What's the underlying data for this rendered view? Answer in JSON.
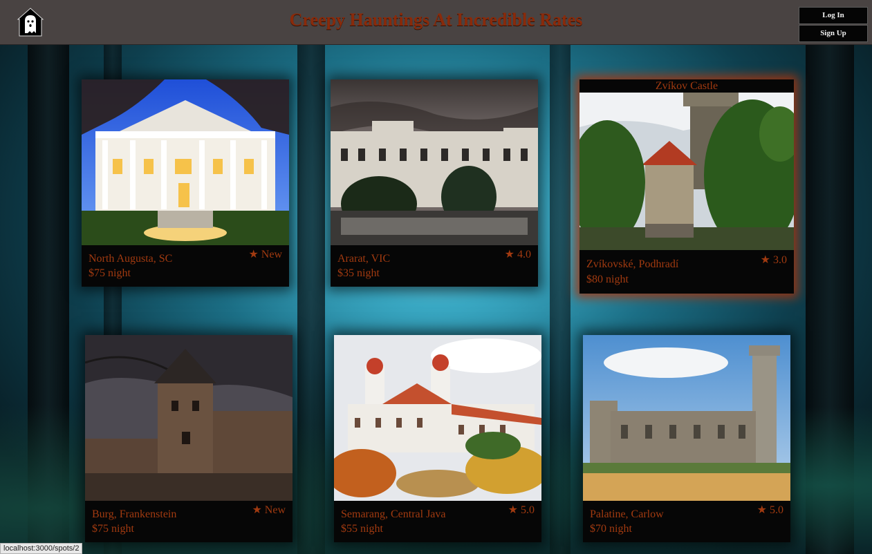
{
  "header": {
    "title": "Creepy Hauntings At Incredible Rates",
    "logo_icon": "ghost-house-icon",
    "login_label": "Log In",
    "signup_label": "Sign Up"
  },
  "colors": {
    "accent": "#a13a10",
    "header_bg": "#494342",
    "card_bg": "#060606"
  },
  "listings": [
    {
      "location": "North Augusta, SC",
      "price": "$75 night",
      "rating": "★ New"
    },
    {
      "location": "Ararat, VIC",
      "price": "$35 night",
      "rating": "★ 4.0"
    },
    {
      "name": "Zvíkov Castle",
      "location": "Zvíkovské, Podhradí",
      "price": "$80 night",
      "rating": "★ 3.0"
    },
    {
      "location": "Burg, Frankenstein",
      "price": "$75 night",
      "rating": "★ New"
    },
    {
      "location": "Semarang, Central Java",
      "price": "$55 night",
      "rating": "★ 5.0"
    },
    {
      "location": "Palatine, Carlow",
      "price": "$70 night",
      "rating": "★ 5.0"
    }
  ],
  "status_bar": "localhost:3000/spots/2"
}
